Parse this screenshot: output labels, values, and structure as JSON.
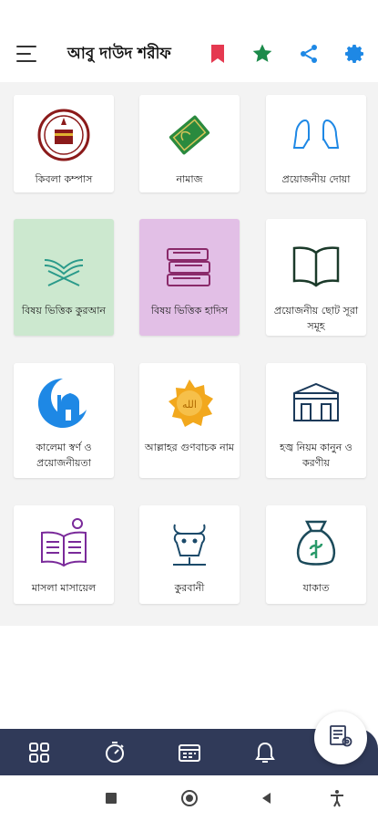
{
  "appbar": {
    "title": "আবু দাউদ শরীফ",
    "icons": [
      "menu-icon",
      "bookmark-icon",
      "star-icon",
      "share-icon",
      "settings-icon"
    ],
    "colors": {
      "bookmark": "#e53950",
      "star": "#1b8a4a",
      "share": "#1e88e5",
      "settings": "#1e88e5"
    }
  },
  "grid": {
    "items": [
      {
        "label": "কিবলা কম্পাস",
        "icon": "qibla-compass-icon",
        "bg": "#ffffff"
      },
      {
        "label": "নামাজ",
        "icon": "prayer-mat-icon",
        "bg": "#ffffff"
      },
      {
        "label": "প্রয়োজনীয় দোয়া",
        "icon": "praying-hands-icon",
        "bg": "#ffffff"
      },
      {
        "label": "বিষয় ভিত্তিক কুরআন",
        "icon": "quran-stand-icon",
        "bg": "#cce8cf"
      },
      {
        "label": "বিষয় ভিত্তিক হাদিস",
        "icon": "books-icon",
        "bg": "#e2bfe6"
      },
      {
        "label": "প্রয়োজনীয় ছোট সূরা সমূহ",
        "icon": "open-book-icon",
        "bg": "#ffffff"
      },
      {
        "label": "কালেমা স্বর্ণ ও প্রয়োজনীয়তা",
        "icon": "mosque-moon-icon",
        "bg": "#ffffff"
      },
      {
        "label": "আল্লাহর গুণবাচক নাম",
        "icon": "allah-badge-icon",
        "bg": "#ffffff"
      },
      {
        "label": "হজ্ব নিয়ম কানুন ও করণীয়",
        "icon": "kaaba-icon",
        "bg": "#ffffff"
      },
      {
        "label": "মাসলা মাসায়েল",
        "icon": "book-idea-icon",
        "bg": "#ffffff"
      },
      {
        "label": "কুরবানী",
        "icon": "cow-icon",
        "bg": "#ffffff"
      },
      {
        "label": "যাকাত",
        "icon": "money-bag-icon",
        "bg": "#ffffff"
      }
    ]
  },
  "bottomnav": {
    "icons": [
      "grid-icon",
      "timer-icon",
      "calendar-icon",
      "bell-icon",
      "list-settings-icon"
    ],
    "color": "#303a59"
  },
  "sysnav": {
    "icons": [
      "recents-icon",
      "home-icon",
      "back-icon",
      "accessibility-icon"
    ]
  }
}
